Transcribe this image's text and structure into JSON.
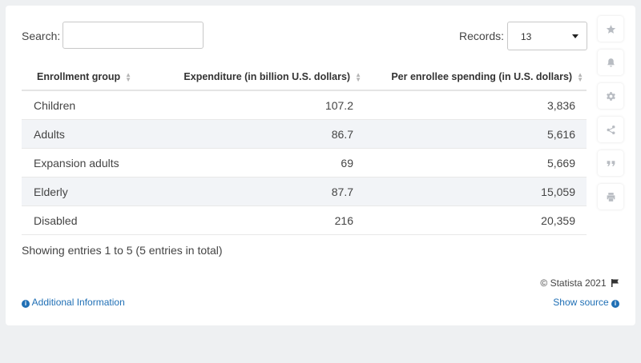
{
  "search": {
    "label": "Search:",
    "value": "",
    "placeholder": ""
  },
  "records": {
    "label": "Records:",
    "value": "13"
  },
  "table": {
    "headers": [
      "Enrollment group",
      "Expenditure (in billion U.S. dollars)",
      "Per enrollee spending (in U.S. dollars)"
    ],
    "rows": [
      [
        "Children",
        "107.2",
        "3,836"
      ],
      [
        "Adults",
        "86.7",
        "5,616"
      ],
      [
        "Expansion adults",
        "69",
        "5,669"
      ],
      [
        "Elderly",
        "87.7",
        "15,059"
      ],
      [
        "Disabled",
        "216",
        "20,359"
      ]
    ]
  },
  "chart_data": {
    "type": "table",
    "columns": [
      "Enrollment group",
      "Expenditure (in billion U.S. dollars)",
      "Per enrollee spending (in U.S. dollars)"
    ],
    "categories": [
      "Children",
      "Adults",
      "Expansion adults",
      "Elderly",
      "Disabled"
    ],
    "series": [
      {
        "name": "Expenditure (in billion U.S. dollars)",
        "values": [
          107.2,
          86.7,
          69,
          87.7,
          216
        ]
      },
      {
        "name": "Per enrollee spending (in U.S. dollars)",
        "values": [
          3836,
          5616,
          5669,
          15059,
          20359
        ]
      }
    ]
  },
  "footer": {
    "showing": "Showing entries 1 to 5 (5 entries in total)",
    "copyright": "© Statista 2021",
    "additional_info": "Additional Information",
    "show_source": "Show source",
    "link_color": "#1f6fb5"
  },
  "sidebar": {
    "icons": [
      "star-icon",
      "bell-icon",
      "gear-icon",
      "share-icon",
      "quote-icon",
      "print-icon"
    ]
  }
}
